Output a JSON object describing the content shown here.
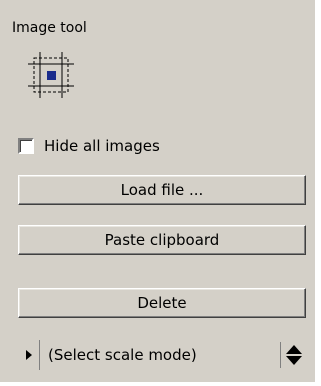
{
  "panel": {
    "title": "Image tool",
    "tool_icon": "image-frame-icon"
  },
  "hide_images": {
    "label": "Hide all images",
    "checked": false
  },
  "buttons": {
    "load": "Load file ...",
    "paste": "Paste clipboard",
    "delete": "Delete"
  },
  "scale_mode": {
    "label": "(Select scale mode)",
    "arrow_icon": "play-arrow-icon",
    "spinner_icon": "up-down-spinner-icon"
  },
  "colors": {
    "background": "#d4d0c8",
    "icon_fill": "#1a2c8c"
  }
}
